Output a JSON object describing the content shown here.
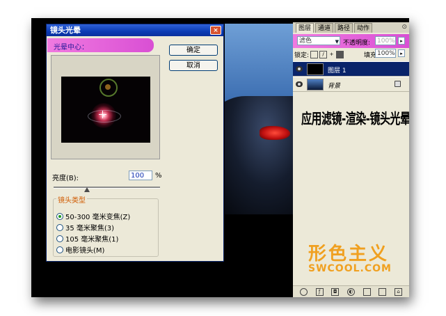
{
  "dialog": {
    "title": "镜头光晕",
    "close_glyph": "×",
    "flare_center_label": "光晕中心：",
    "ok_label": "确定",
    "cancel_label": "取消",
    "brightness_label": "亮度(B):",
    "brightness_value": "100",
    "brightness_unit": "%",
    "brightness_slider_percent": 100,
    "lens_type_label": "镜头类型",
    "lens_types": [
      {
        "label": "50-300 毫米变焦(Z)",
        "selected": true
      },
      {
        "label": "35 毫米聚焦(3)",
        "selected": false
      },
      {
        "label": "105 毫米聚焦(1)",
        "selected": false
      },
      {
        "label": "电影镜头(M)",
        "selected": false
      }
    ]
  },
  "layers_panel": {
    "tabs": [
      "图层",
      "通道",
      "路径",
      "动作"
    ],
    "active_tab": 0,
    "blend_mode": "滤色",
    "opacity_label": "不透明度:",
    "opacity_value": "100%",
    "lock_label": "锁定:",
    "fill_label": "填充:",
    "fill_value": "100%",
    "layers": [
      {
        "name": "图层 1",
        "selected": true,
        "thumb_color": "#000000"
      },
      {
        "name": "背景",
        "selected": false,
        "thumb_color": "#1d3f7a",
        "locked": true
      }
    ],
    "caption": "应用滤镜-渲染-镜头光晕",
    "logo_cn": "形色主义",
    "logo_en": "SWCOOL.COM"
  },
  "colors": {
    "title_bar": "#0b3bb4",
    "highlight_pink": "#e060d8",
    "logo_orange": "#f0a020",
    "selected_layer": "#0a246a"
  },
  "icons": [
    "close-icon",
    "eye-icon",
    "lock-icon",
    "link-icon",
    "fx-icon",
    "mask-icon",
    "adjustment-icon",
    "folder-icon",
    "new-layer-icon",
    "trash-icon"
  ]
}
